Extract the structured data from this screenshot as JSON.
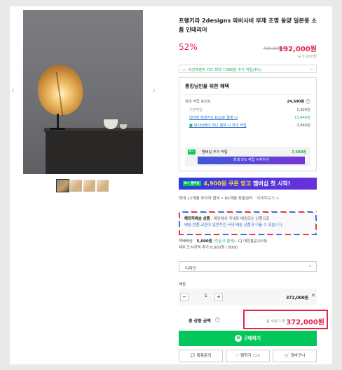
{
  "product": {
    "title": "프랭키라 2designs 와비사비 부채 조명 동양 일본풍 소품 인테리어",
    "discount": "52%",
    "original_price": "400,000원",
    "sale_price": "192,000원",
    "shipping": "5,000원"
  },
  "card_promo": "라인프렌즈 카드 최대 7,680원 추가 적립(4%)",
  "benefits": {
    "heading": "통킹님만을 위한 혜택",
    "rows": [
      {
        "label": "최대 적립 포인트",
        "value": "24,690원"
      },
      {
        "label": "기본적립",
        "value": "1,920원"
      },
      {
        "label": "네이버 현대카드 Ed2로 결제 시",
        "value": "13,440원"
      },
      {
        "label": "네이버페이 머니 결제 시 최대 적립",
        "value": "3,840원"
      }
    ],
    "membership_badge": "N+",
    "membership_label": "멤버십 추가 적립",
    "membership_value": "7,680원",
    "membership_button": "최대 5% 적립 시작하기"
  },
  "banner": {
    "badge": "N+ 멤버십",
    "highlight": "4,900원 쿠폰 받고",
    "text": " 멤버십 첫 시작!"
  },
  "installment": {
    "text": "최대 12개월 무이자 할부 • 60개월 특별금리",
    "more": "자세히보기 >"
  },
  "notice": {
    "badge": "해외직배송 상품",
    "line1": " : 해외에서 국내로 배송되는 상품으로",
    "line2": "배송·반품·교환이 일반적인 국내 배송 상품과 다를 수 있습니다."
  },
  "delivery": {
    "label": "택배배송",
    "fee": "5,000원",
    "cond": "(주문시 결제)",
    "carrier": "· CJ 대한통운(오네)",
    "extra": "제주,도서지역 추가 8,000원 / 8000"
  },
  "option": {
    "select_placeholder": "디자인",
    "label": "백동",
    "quantity": "1",
    "price": "372,000원"
  },
  "total": {
    "label": "총 상품 금액",
    "count": "총 수량 1개",
    "amount": "372,000원"
  },
  "buttons": {
    "buy": "구매하기",
    "talk": "톡톡문의",
    "wish": "찜하기",
    "wish_count": "118",
    "cart": "장바구니"
  },
  "icons": {
    "prev": "chevron-left-icon",
    "next": "chevron-right-icon",
    "card": "card-icon",
    "talk": "chat-icon",
    "wish": "heart-icon",
    "cart": "cart-icon"
  },
  "colors": {
    "accent": "#e8244f",
    "naver_green": "#03c75a"
  }
}
